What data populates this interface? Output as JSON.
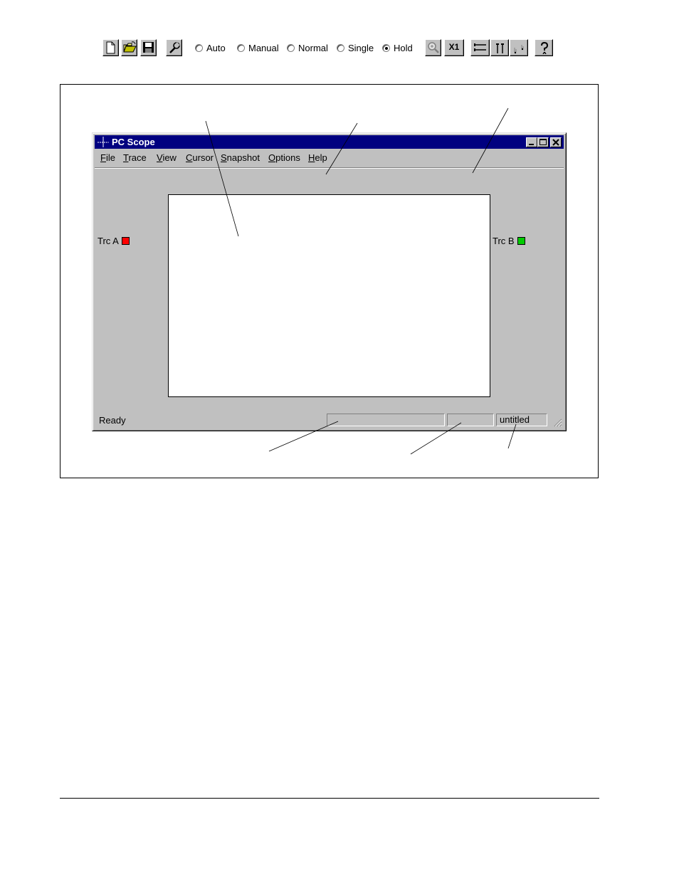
{
  "window": {
    "title": "PC Scope",
    "buttons": [
      "minimize",
      "maximize",
      "close"
    ]
  },
  "menu": {
    "items": [
      "File",
      "Trace",
      "View",
      "Cursor",
      "Snapshot",
      "Options",
      "Help"
    ],
    "mnemonics": [
      "F",
      "T",
      "V",
      "C",
      "S",
      "O",
      "H"
    ]
  },
  "toolbar": {
    "file_buttons": [
      "new-file-icon",
      "open-folder-icon",
      "save-disk-icon"
    ],
    "settings_button": "wrench-icon",
    "trigger_modes": [
      {
        "label": "Auto",
        "checked": false
      },
      {
        "label": "Manual",
        "checked": false
      },
      {
        "label": "Normal",
        "checked": false
      },
      {
        "label": "Single",
        "checked": false
      },
      {
        "label": "Hold",
        "checked": true
      }
    ],
    "zoom_button": "zoom-icon",
    "x1_label": "X1",
    "cursor_buttons": [
      "horizontal-cursor-icon",
      "vertical-cursor-icon",
      "trace-cursor-icon"
    ],
    "help_button": "help-icon"
  },
  "traces": {
    "a": {
      "label": "Trc A",
      "color": "#ff0000"
    },
    "b": {
      "label": "Trc B",
      "color": "#00cc00"
    }
  },
  "status": {
    "text": "Ready",
    "file_name": "untitled"
  },
  "colors": {
    "titlebar": "#000080",
    "face": "#c0c0c0"
  }
}
